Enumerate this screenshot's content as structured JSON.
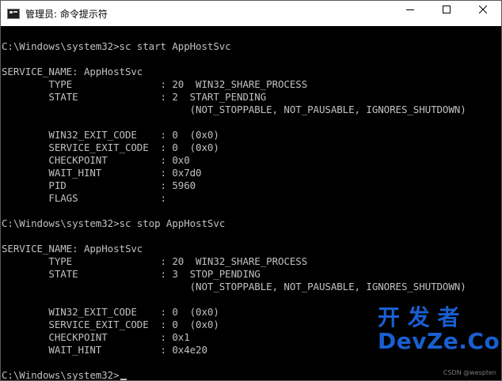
{
  "window": {
    "title": "管理员: 命令提示符",
    "app_icon": "cmd-app-icon",
    "controls": {
      "minimize_icon": "minimize-icon",
      "maximize_icon": "maximize-icon",
      "close_icon": "close-icon"
    }
  },
  "console": {
    "lines": [
      "C:\\Windows\\system32>sc start AppHostSvc",
      "",
      "SERVICE_NAME: AppHostSvc",
      "        TYPE               : 20  WIN32_SHARE_PROCESS",
      "        STATE              : 2  START_PENDING",
      "                                (NOT_STOPPABLE, NOT_PAUSABLE, IGNORES_SHUTDOWN)",
      "",
      "        WIN32_EXIT_CODE    : 0  (0x0)",
      "        SERVICE_EXIT_CODE  : 0  (0x0)",
      "        CHECKPOINT         : 0x0",
      "        WAIT_HINT          : 0x7d0",
      "        PID                : 5960",
      "        FLAGS              :",
      "",
      "C:\\Windows\\system32>sc stop AppHostSvc",
      "",
      "SERVICE_NAME: AppHostSvc",
      "        TYPE               : 20  WIN32_SHARE_PROCESS",
      "        STATE              : 3  STOP_PENDING",
      "                                (NOT_STOPPABLE, NOT_PAUSABLE, IGNORES_SHUTDOWN)",
      "",
      "        WIN32_EXIT_CODE    : 0  (0x0)",
      "        SERVICE_EXIT_CODE  : 0  (0x0)",
      "        CHECKPOINT         : 0x1",
      "        WAIT_HINT          : 0x4e20",
      "",
      "C:\\Windows\\system32>"
    ],
    "text_color": "#c0c0c0",
    "background_color": "#000000"
  },
  "watermark": {
    "line1": "开 发 者",
    "line2": "DevZe.CoM",
    "small": "CSDN @wespten",
    "color": "#1a5fd0"
  }
}
